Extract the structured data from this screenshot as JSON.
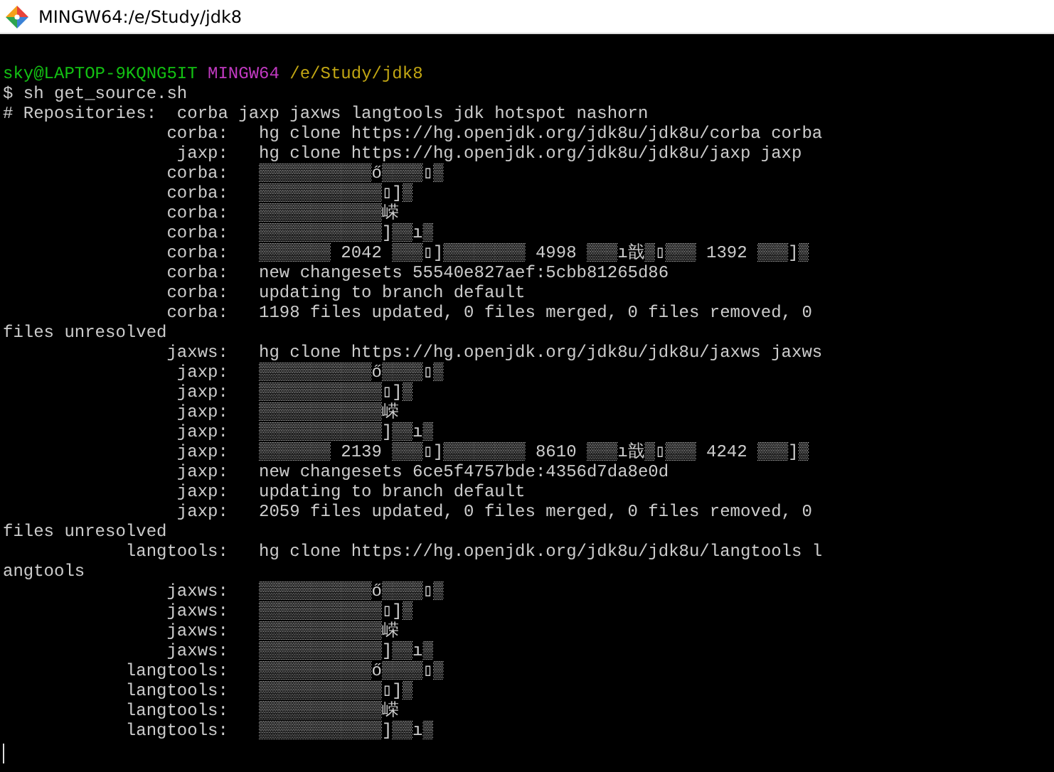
{
  "window": {
    "title": "MINGW64:/e/Study/jdk8"
  },
  "prompt": {
    "user": "sky@LAPTOP-9KQNG5IT",
    "host": "MINGW64",
    "path": "/e/Study/jdk8"
  },
  "lines": [
    "$ sh get_source.sh",
    "# Repositories:  corba jaxp jaxws langtools jdk hotspot nashorn",
    "                corba:   hg clone https://hg.openjdk.org/jdk8u/jdk8u/corba corba",
    "                 jaxp:   hg clone https://hg.openjdk.org/jdk8u/jdk8u/jaxp jaxp",
    "                corba:   ▒▒▒▒▒▒▒▒▒▒▒ő▒▒▒▒▯▒",
    "                corba:   ▒▒▒▒▒▒▒▒▒▒▒▒▯]▒",
    "                corba:   ▒▒▒▒▒▒▒▒▒▒▒▒嵘",
    "                corba:   ▒▒▒▒▒▒▒▒▒▒▒▒]▒▒ı▒",
    "                corba:   ▒▒▒▒▒▒▒ 2042 ▒▒▒▯]▒▒▒▒▒▒▒▒ 4998 ▒▒▒ı戠▒▯▒▒▒ 1392 ▒▒▒]▒",
    "                corba:   new changesets 55540e827aef:5cbb81265d86",
    "                corba:   updating to branch default",
    "                corba:   1198 files updated, 0 files merged, 0 files removed, 0",
    "files unresolved",
    "                jaxws:   hg clone https://hg.openjdk.org/jdk8u/jdk8u/jaxws jaxws",
    "                 jaxp:   ▒▒▒▒▒▒▒▒▒▒▒ő▒▒▒▒▯▒",
    "                 jaxp:   ▒▒▒▒▒▒▒▒▒▒▒▒▯]▒",
    "                 jaxp:   ▒▒▒▒▒▒▒▒▒▒▒▒嵘",
    "                 jaxp:   ▒▒▒▒▒▒▒▒▒▒▒▒]▒▒ı▒",
    "                 jaxp:   ▒▒▒▒▒▒▒ 2139 ▒▒▒▯]▒▒▒▒▒▒▒▒ 8610 ▒▒▒ı戠▒▯▒▒▒ 4242 ▒▒▒]▒",
    "                 jaxp:   new changesets 6ce5f4757bde:4356d7da8e0d",
    "                 jaxp:   updating to branch default",
    "                 jaxp:   2059 files updated, 0 files merged, 0 files removed, 0",
    "files unresolved",
    "            langtools:   hg clone https://hg.openjdk.org/jdk8u/jdk8u/langtools l",
    "angtools",
    "                jaxws:   ▒▒▒▒▒▒▒▒▒▒▒ő▒▒▒▒▯▒",
    "                jaxws:   ▒▒▒▒▒▒▒▒▒▒▒▒▯]▒",
    "                jaxws:   ▒▒▒▒▒▒▒▒▒▒▒▒嵘",
    "                jaxws:   ▒▒▒▒▒▒▒▒▒▒▒▒]▒▒ı▒",
    "            langtools:   ▒▒▒▒▒▒▒▒▒▒▒ő▒▒▒▒▯▒",
    "            langtools:   ▒▒▒▒▒▒▒▒▒▒▒▒▯]▒",
    "            langtools:   ▒▒▒▒▒▒▒▒▒▒▒▒嵘",
    "            langtools:   ▒▒▒▒▒▒▒▒▒▒▒▒]▒▒ı▒"
  ]
}
